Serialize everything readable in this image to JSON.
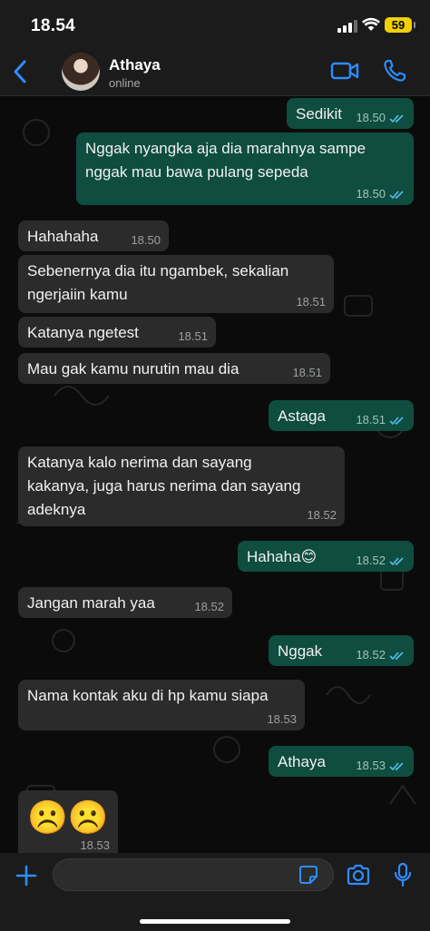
{
  "status_bar": {
    "time": "18.54",
    "battery": "59"
  },
  "header": {
    "contact_name": "Athaya",
    "contact_status": "online"
  },
  "messages": [
    {
      "dir": "out",
      "text": "Sedikit",
      "time": "18.50"
    },
    {
      "dir": "out",
      "text": "Nggak nyangka aja dia marahnya sampe\nnggak mau bawa pulang sepeda",
      "time": "18.50"
    },
    {
      "dir": "in",
      "text": "Hahahaha",
      "time": "18.50"
    },
    {
      "dir": "in",
      "text": "Sebenernya dia itu ngambek, sekalian\nngerjaiin kamu",
      "time": "18.51"
    },
    {
      "dir": "in",
      "text": "Katanya ngetest",
      "time": "18.51"
    },
    {
      "dir": "in",
      "text": "Mau gak kamu nurutin mau dia",
      "time": "18.51"
    },
    {
      "dir": "out",
      "text": "Astaga",
      "time": "18.51"
    },
    {
      "dir": "in",
      "text": "Katanya kalo nerima dan sayang\nkakanya, juga harus nerima dan sayang\nadeknya",
      "time": "18.52"
    },
    {
      "dir": "out",
      "text": "Hahaha😊",
      "time": "18.52"
    },
    {
      "dir": "in",
      "text": "Jangan marah yaa",
      "time": "18.52"
    },
    {
      "dir": "out",
      "text": "Nggak",
      "time": "18.52"
    },
    {
      "dir": "in",
      "text": "Nama kontak aku di hp kamu siapa",
      "time": "18.53"
    },
    {
      "dir": "out",
      "text": "Athaya",
      "time": "18.53"
    },
    {
      "dir": "in",
      "text": "☹️☹️",
      "time": "18.53"
    }
  ],
  "colors": {
    "incoming_bubble": "#2b2b2b",
    "outgoing_bubble": "#0e4d3f",
    "accent": "#2f8cff",
    "read_ticks": "#53bdeb"
  },
  "icons": {
    "back": "chevron-left-icon",
    "video": "video-camera-icon",
    "call": "phone-icon",
    "plus": "plus-icon",
    "sticker": "sticker-icon",
    "camera": "camera-icon",
    "mic": "microphone-icon"
  }
}
